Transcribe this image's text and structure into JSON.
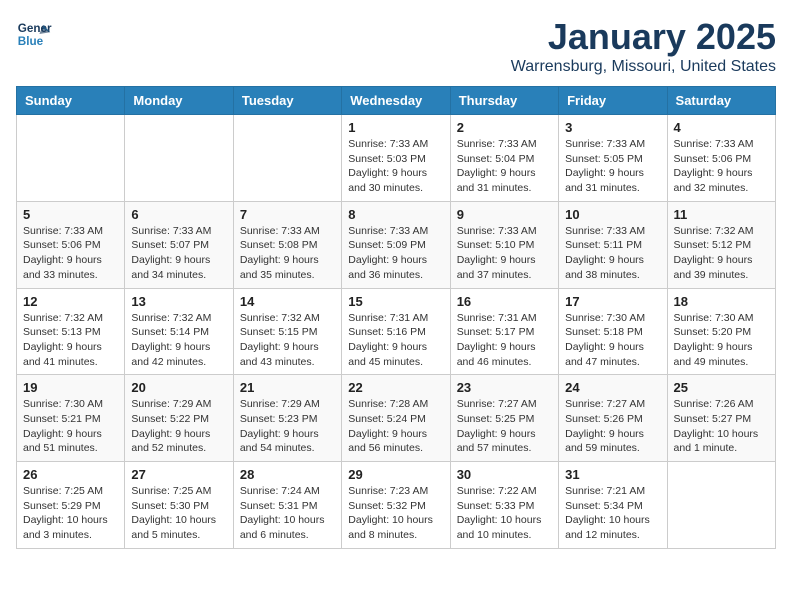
{
  "logo": {
    "line1": "General",
    "line2": "Blue"
  },
  "title": "January 2025",
  "subtitle": "Warrensburg, Missouri, United States",
  "weekdays": [
    "Sunday",
    "Monday",
    "Tuesday",
    "Wednesday",
    "Thursday",
    "Friday",
    "Saturday"
  ],
  "weeks": [
    [
      {
        "day": "",
        "info": ""
      },
      {
        "day": "",
        "info": ""
      },
      {
        "day": "",
        "info": ""
      },
      {
        "day": "1",
        "info": "Sunrise: 7:33 AM\nSunset: 5:03 PM\nDaylight: 9 hours\nand 30 minutes."
      },
      {
        "day": "2",
        "info": "Sunrise: 7:33 AM\nSunset: 5:04 PM\nDaylight: 9 hours\nand 31 minutes."
      },
      {
        "day": "3",
        "info": "Sunrise: 7:33 AM\nSunset: 5:05 PM\nDaylight: 9 hours\nand 31 minutes."
      },
      {
        "day": "4",
        "info": "Sunrise: 7:33 AM\nSunset: 5:06 PM\nDaylight: 9 hours\nand 32 minutes."
      }
    ],
    [
      {
        "day": "5",
        "info": "Sunrise: 7:33 AM\nSunset: 5:06 PM\nDaylight: 9 hours\nand 33 minutes."
      },
      {
        "day": "6",
        "info": "Sunrise: 7:33 AM\nSunset: 5:07 PM\nDaylight: 9 hours\nand 34 minutes."
      },
      {
        "day": "7",
        "info": "Sunrise: 7:33 AM\nSunset: 5:08 PM\nDaylight: 9 hours\nand 35 minutes."
      },
      {
        "day": "8",
        "info": "Sunrise: 7:33 AM\nSunset: 5:09 PM\nDaylight: 9 hours\nand 36 minutes."
      },
      {
        "day": "9",
        "info": "Sunrise: 7:33 AM\nSunset: 5:10 PM\nDaylight: 9 hours\nand 37 minutes."
      },
      {
        "day": "10",
        "info": "Sunrise: 7:33 AM\nSunset: 5:11 PM\nDaylight: 9 hours\nand 38 minutes."
      },
      {
        "day": "11",
        "info": "Sunrise: 7:32 AM\nSunset: 5:12 PM\nDaylight: 9 hours\nand 39 minutes."
      }
    ],
    [
      {
        "day": "12",
        "info": "Sunrise: 7:32 AM\nSunset: 5:13 PM\nDaylight: 9 hours\nand 41 minutes."
      },
      {
        "day": "13",
        "info": "Sunrise: 7:32 AM\nSunset: 5:14 PM\nDaylight: 9 hours\nand 42 minutes."
      },
      {
        "day": "14",
        "info": "Sunrise: 7:32 AM\nSunset: 5:15 PM\nDaylight: 9 hours\nand 43 minutes."
      },
      {
        "day": "15",
        "info": "Sunrise: 7:31 AM\nSunset: 5:16 PM\nDaylight: 9 hours\nand 45 minutes."
      },
      {
        "day": "16",
        "info": "Sunrise: 7:31 AM\nSunset: 5:17 PM\nDaylight: 9 hours\nand 46 minutes."
      },
      {
        "day": "17",
        "info": "Sunrise: 7:30 AM\nSunset: 5:18 PM\nDaylight: 9 hours\nand 47 minutes."
      },
      {
        "day": "18",
        "info": "Sunrise: 7:30 AM\nSunset: 5:20 PM\nDaylight: 9 hours\nand 49 minutes."
      }
    ],
    [
      {
        "day": "19",
        "info": "Sunrise: 7:30 AM\nSunset: 5:21 PM\nDaylight: 9 hours\nand 51 minutes."
      },
      {
        "day": "20",
        "info": "Sunrise: 7:29 AM\nSunset: 5:22 PM\nDaylight: 9 hours\nand 52 minutes."
      },
      {
        "day": "21",
        "info": "Sunrise: 7:29 AM\nSunset: 5:23 PM\nDaylight: 9 hours\nand 54 minutes."
      },
      {
        "day": "22",
        "info": "Sunrise: 7:28 AM\nSunset: 5:24 PM\nDaylight: 9 hours\nand 56 minutes."
      },
      {
        "day": "23",
        "info": "Sunrise: 7:27 AM\nSunset: 5:25 PM\nDaylight: 9 hours\nand 57 minutes."
      },
      {
        "day": "24",
        "info": "Sunrise: 7:27 AM\nSunset: 5:26 PM\nDaylight: 9 hours\nand 59 minutes."
      },
      {
        "day": "25",
        "info": "Sunrise: 7:26 AM\nSunset: 5:27 PM\nDaylight: 10 hours\nand 1 minute."
      }
    ],
    [
      {
        "day": "26",
        "info": "Sunrise: 7:25 AM\nSunset: 5:29 PM\nDaylight: 10 hours\nand 3 minutes."
      },
      {
        "day": "27",
        "info": "Sunrise: 7:25 AM\nSunset: 5:30 PM\nDaylight: 10 hours\nand 5 minutes."
      },
      {
        "day": "28",
        "info": "Sunrise: 7:24 AM\nSunset: 5:31 PM\nDaylight: 10 hours\nand 6 minutes."
      },
      {
        "day": "29",
        "info": "Sunrise: 7:23 AM\nSunset: 5:32 PM\nDaylight: 10 hours\nand 8 minutes."
      },
      {
        "day": "30",
        "info": "Sunrise: 7:22 AM\nSunset: 5:33 PM\nDaylight: 10 hours\nand 10 minutes."
      },
      {
        "day": "31",
        "info": "Sunrise: 7:21 AM\nSunset: 5:34 PM\nDaylight: 10 hours\nand 12 minutes."
      },
      {
        "day": "",
        "info": ""
      }
    ]
  ]
}
